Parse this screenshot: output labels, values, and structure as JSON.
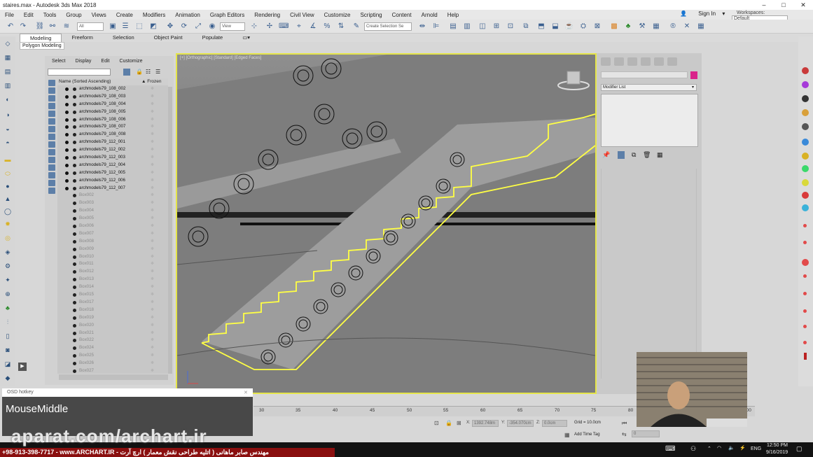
{
  "window": {
    "title": "staires.max - Autodesk 3ds Max 2018"
  },
  "menu": [
    "File",
    "Edit",
    "Tools",
    "Group",
    "Views",
    "Create",
    "Modifiers",
    "Animation",
    "Graph Editors",
    "Rendering",
    "Civil View",
    "Customize",
    "Scripting",
    "Content",
    "Arnold",
    "Help"
  ],
  "signin": "Sign In",
  "workspaces": {
    "label": "Workspaces:",
    "value": "Default"
  },
  "toolbar": {
    "filter": "All",
    "ref": "View",
    "selset": "Create Selection Se"
  },
  "ribbon": {
    "tabs": [
      "Modeling",
      "Freeform",
      "Selection",
      "Object Paint",
      "Populate"
    ],
    "active": "Modeling",
    "sub": "Polygon Modeling"
  },
  "scene_explorer": {
    "tabs": [
      "Select",
      "Display",
      "Edit",
      "Customize"
    ],
    "col_name": "Name (Sorted Ascending)",
    "col_frozen": "Frozen",
    "visible_rows": [
      "archmodels79_108_002",
      "archmodels79_108_003",
      "archmodels79_108_004",
      "archmodels79_108_005",
      "archmodels79_108_006",
      "archmodels79_108_007",
      "archmodels79_108_008",
      "archmodels79_112_001",
      "archmodels79_112_002",
      "archmodels79_112_003",
      "archmodels79_112_004",
      "archmodels79_112_005",
      "archmodels79_112_006",
      "archmodels79_112_007"
    ],
    "hidden_rows": [
      "Box002",
      "Box003",
      "Box004",
      "Box005",
      "Box006",
      "Box007",
      "Box008",
      "Box009",
      "Box010",
      "Box011",
      "Box012",
      "Box013",
      "Box014",
      "Box015",
      "Box017",
      "Box018",
      "Box019",
      "Box020",
      "Box021",
      "Box022",
      "Box024",
      "Box025",
      "Box026",
      "Box027"
    ]
  },
  "viewport": {
    "label": "[+] [Orthographic] [Standard] [Edged Faces]"
  },
  "command_panel": {
    "modifier_list": "Modifier List",
    "swatch_color": "#d9238a"
  },
  "timeline": {
    "ticks": [
      "30",
      "35",
      "40",
      "45",
      "50",
      "55",
      "60",
      "65",
      "70",
      "75",
      "80",
      "85",
      "90",
      "95",
      "100"
    ]
  },
  "status": {
    "x": "X:",
    "x_val": "1392.748m",
    "y": "Y:",
    "y_val": "-354.070cm",
    "z": "Z:",
    "z_val": "0.0cm",
    "grid": "Grid = 10.0cm",
    "add_time_tag": "Add Time Tag",
    "set_key": "Set Key",
    "key_filters": "Key Filters...",
    "frame": "0"
  },
  "osd": {
    "title": "OSD hotkey",
    "text": "MouseMiddle"
  },
  "watermark": "aparat.com/archart.ir",
  "phone": "+98-913-398-7717 - www.ARCHART.IR - مهندس صابر ماهانی ( اتلیه طراحی نقش معمار ) ارچ آرت",
  "tray": {
    "lang": "ENG",
    "time": "12:50 PM",
    "date": "9/16/2019"
  }
}
